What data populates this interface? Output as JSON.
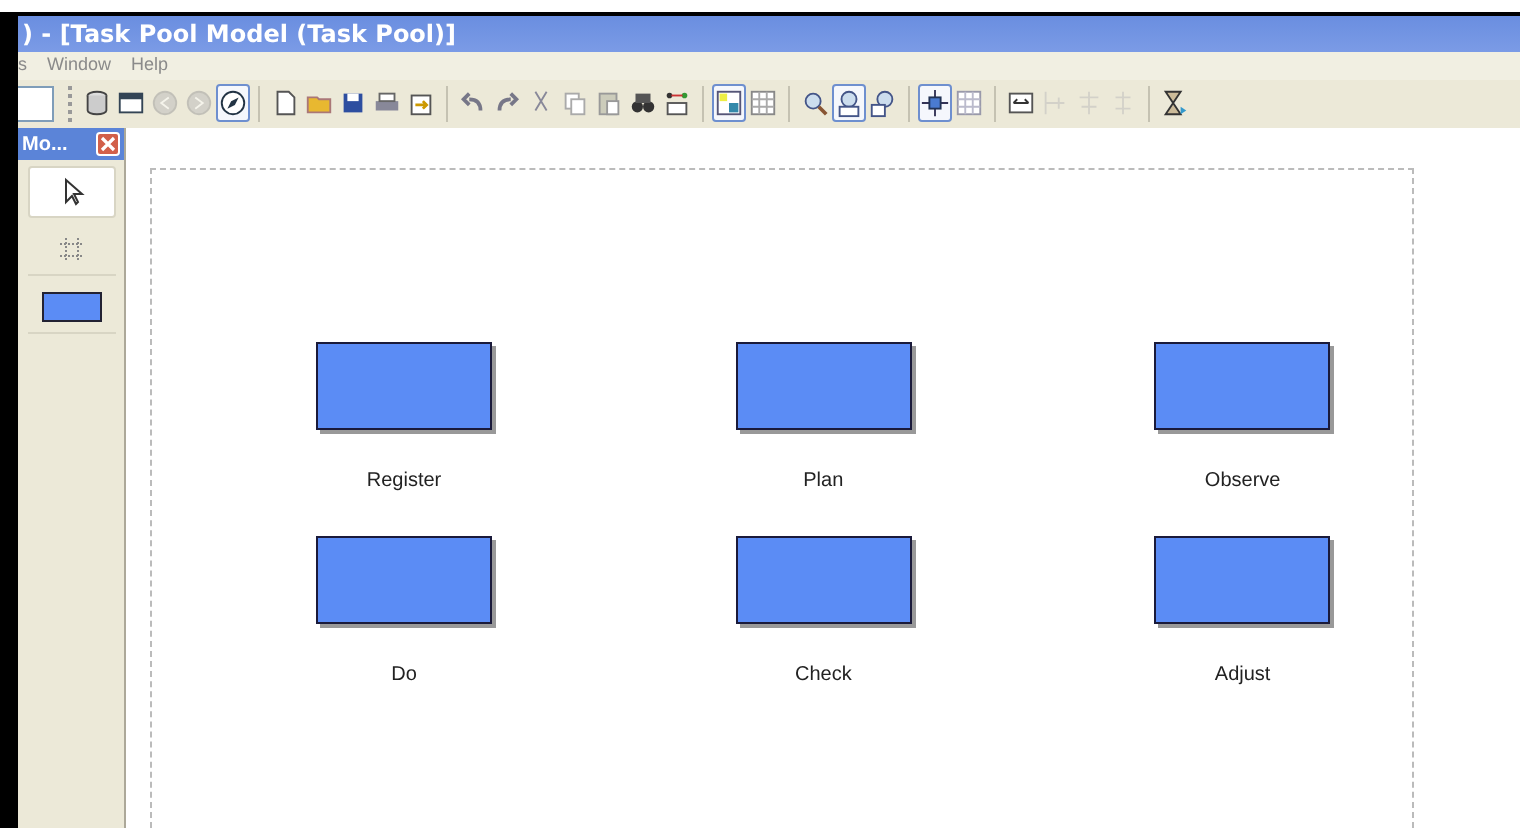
{
  "window": {
    "title": ") - [Task Pool Model (Task Pool)]"
  },
  "menu": [
    "s",
    "Window",
    "Help"
  ],
  "toolbar": [
    [
      {
        "pressed": false,
        "disabled": false
      },
      {
        "pressed": false,
        "disabled": false
      },
      {
        "pressed": false,
        "disabled": true
      },
      {
        "pressed": false,
        "disabled": true
      },
      {
        "pressed": true,
        "disabled": false
      }
    ],
    [
      {
        "pressed": false,
        "disabled": false
      },
      {
        "pressed": false,
        "disabled": false
      },
      {
        "pressed": false,
        "disabled": false
      },
      {
        "pressed": false,
        "disabled": false
      },
      {
        "pressed": false,
        "disabled": false
      }
    ],
    [
      {
        "pressed": false,
        "disabled": false
      },
      {
        "pressed": false,
        "disabled": false
      },
      {
        "pressed": false,
        "disabled": false
      },
      {
        "pressed": false,
        "disabled": false
      },
      {
        "pressed": false,
        "disabled": false
      },
      {
        "pressed": false,
        "disabled": false
      },
      {
        "pressed": false,
        "disabled": false
      }
    ],
    [
      {
        "pressed": true,
        "disabled": false
      },
      {
        "pressed": false,
        "disabled": false
      }
    ],
    [
      {
        "pressed": false,
        "disabled": false
      },
      {
        "pressed": true,
        "disabled": false
      },
      {
        "pressed": false,
        "disabled": false
      }
    ],
    [
      {
        "pressed": true,
        "disabled": false
      },
      {
        "pressed": false,
        "disabled": false
      }
    ],
    [
      {
        "pressed": false,
        "disabled": false
      },
      {
        "pressed": false,
        "disabled": true
      },
      {
        "pressed": false,
        "disabled": true
      },
      {
        "pressed": false,
        "disabled": true
      }
    ],
    [
      {
        "pressed": false,
        "disabled": false
      }
    ]
  ],
  "palette": {
    "title": "Mo...",
    "tools": [
      {
        "selected": true
      },
      {
        "selected": false
      },
      {
        "selected": false
      }
    ]
  },
  "nodes": [
    {
      "label": "Register"
    },
    {
      "label": "Plan"
    },
    {
      "label": "Observe"
    },
    {
      "label": "Do"
    },
    {
      "label": "Check"
    },
    {
      "label": "Adjust"
    }
  ]
}
